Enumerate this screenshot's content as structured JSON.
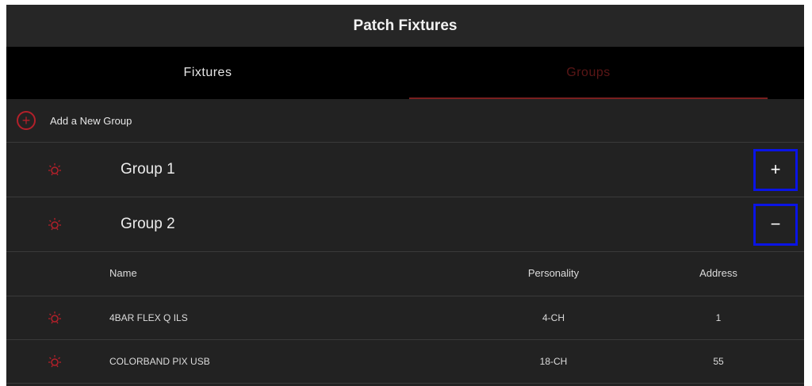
{
  "app": {
    "title": "Patch Fixtures"
  },
  "tabs": [
    {
      "label": "Fixtures",
      "active": false
    },
    {
      "label": "Groups",
      "active": true
    }
  ],
  "add_group": {
    "label": "Add a New Group",
    "icon": "plus-circle-icon"
  },
  "groups": [
    {
      "name": "Group 1",
      "toggle": "+",
      "expanded": false
    },
    {
      "name": "Group 2",
      "toggle": "−",
      "expanded": true
    }
  ],
  "table": {
    "columns": [
      "Name",
      "Personality",
      "Address"
    ],
    "rows": [
      {
        "name": "4BAR FLEX Q ILS",
        "personality": "4-CH",
        "address": "1"
      },
      {
        "name": "COLORBAND PIX USB",
        "personality": "18-CH",
        "address": "55"
      }
    ]
  },
  "colors": {
    "accent": "#b3202a",
    "highlight_box": "#0a14e6",
    "background": "#222222"
  }
}
